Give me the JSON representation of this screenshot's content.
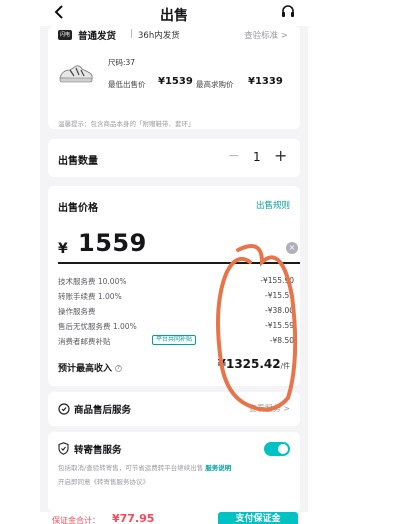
{
  "header": {
    "title": "出售"
  },
  "shipping": {
    "tag": "闪电",
    "type": "普通发货",
    "separator": "|",
    "time": "36h内发货",
    "standard_link": "查验标准 >"
  },
  "product": {
    "size": "尺码:37",
    "lowest_sell_label": "最低出售价",
    "lowest_sell_value": "¥1539",
    "highest_buy_label": "最高求购价",
    "highest_buy_value": "¥1339",
    "tip": "温馨提示：包含商品本身的「附赠鞋带、套环」"
  },
  "quantity": {
    "label": "出售数量",
    "minus": "−",
    "value": "1",
    "plus": "+"
  },
  "price": {
    "label": "出售价格",
    "rules_link": "出售规则",
    "currency": "¥",
    "value": "1559",
    "clear": "×"
  },
  "fees": [
    {
      "label": "技术服务费 10.00%",
      "value": "-¥155.90"
    },
    {
      "label": "转账手续费 1.00%",
      "value": "-¥15.59"
    },
    {
      "label": "操作服务费",
      "value": "-¥38.00"
    },
    {
      "label": "售后无忧服务费 1.00%",
      "value": "-¥15.59"
    },
    {
      "label": "消费者邮费补贴",
      "value": "-¥8.50",
      "badge": "平台共同补贴"
    }
  ],
  "income": {
    "label": "预计最高收入",
    "value": "¥1325.42",
    "unit": "/件"
  },
  "after_sales": {
    "label": "商品售后服务",
    "link": "查看服务 >"
  },
  "consignment": {
    "label": "转寄售服务",
    "enabled": true,
    "desc": "包括取消/查验转寄售，可节省运费转平台继续出售",
    "more_link": "服务说明",
    "agreement": "开启即同意《转寄售服务协议》"
  },
  "bottom_bar": {
    "deposit_label": "保证金合计：",
    "deposit_value": "¥77.95",
    "pay_button": "支付保证金"
  },
  "colors": {
    "accent": "#01c2c3",
    "link": "#01a2a2",
    "danger": "#ff4657",
    "annotation": "#e8744a"
  }
}
